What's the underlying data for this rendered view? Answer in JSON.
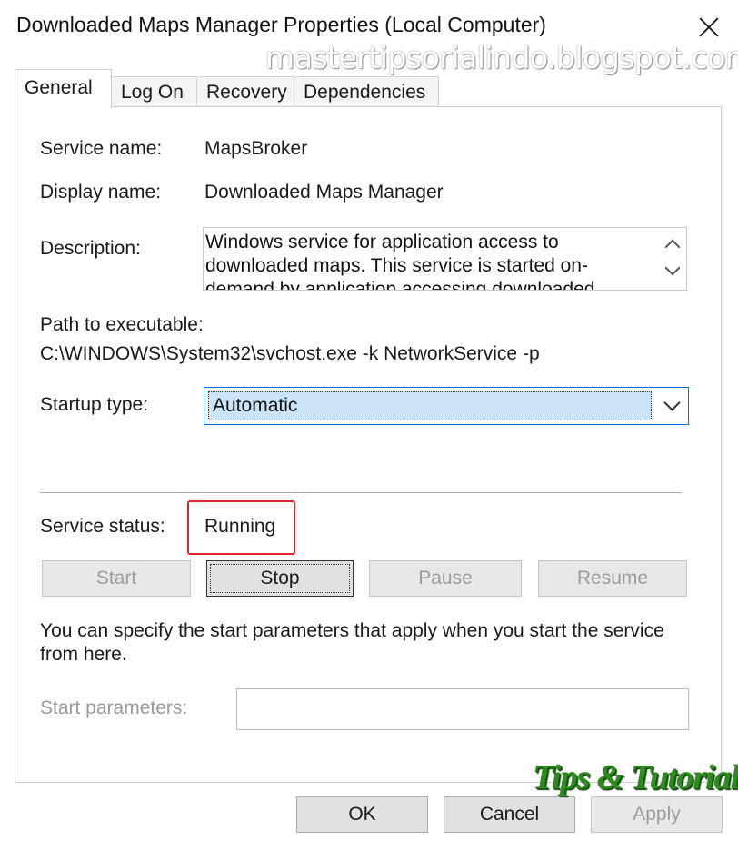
{
  "window": {
    "title": "Downloaded Maps Manager Properties (Local Computer)",
    "watermark": "mastertipsorialindo.blogspot.com"
  },
  "tabs": [
    {
      "label": "General",
      "active": true
    },
    {
      "label": "Log On",
      "active": false
    },
    {
      "label": "Recovery",
      "active": false
    },
    {
      "label": "Dependencies",
      "active": false
    }
  ],
  "general": {
    "service_name_label": "Service name:",
    "service_name": "MapsBroker",
    "display_name_label": "Display name:",
    "display_name": "Downloaded Maps Manager",
    "description_label": "Description:",
    "description": "Windows service for application access to downloaded maps. This service is started on-demand by application accessing downloaded",
    "path_label": "Path to executable:",
    "path": "C:\\WINDOWS\\System32\\svchost.exe -k NetworkService -p",
    "startup_type_label": "Startup type:",
    "startup_type": "Automatic",
    "service_status_label": "Service status:",
    "service_status": "Running",
    "buttons": {
      "start": "Start",
      "stop": "Stop",
      "pause": "Pause",
      "resume": "Resume"
    },
    "info_text": "You can specify the start parameters that apply when you start the service from here.",
    "start_parameters_label": "Start parameters:",
    "start_parameters_value": ""
  },
  "footer": {
    "ok": "OK",
    "cancel": "Cancel",
    "apply": "Apply"
  },
  "branding": {
    "text": "Tips & Tutorial"
  },
  "colors": {
    "highlight_box": "#d9262b",
    "select_focus": "#0a6fd6",
    "select_highlight": "#cce4f7",
    "brand_green": "#2e8b1f"
  }
}
